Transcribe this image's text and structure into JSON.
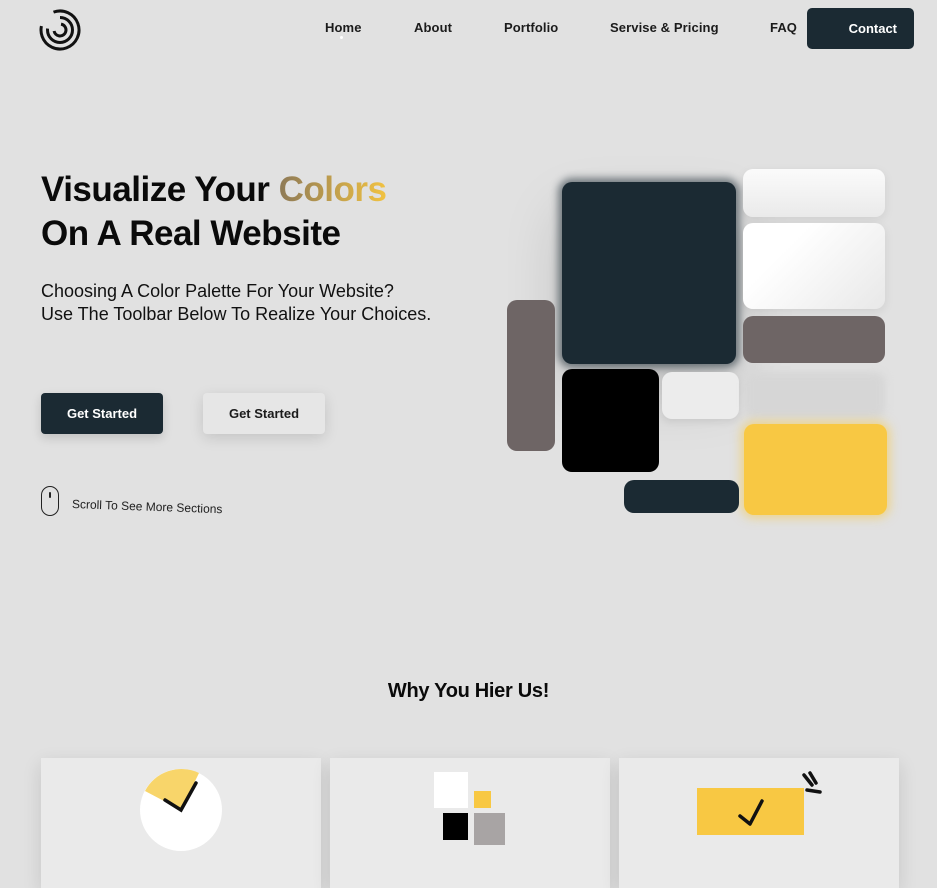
{
  "header": {
    "logo_icon": "spiral-logo-icon",
    "nav": [
      {
        "label": "Home"
      },
      {
        "label": "About"
      },
      {
        "label": "Portfolio"
      },
      {
        "label": "Servise & Pricing"
      },
      {
        "label": "FAQ"
      }
    ],
    "contact_label": "Contact"
  },
  "hero": {
    "title_part1": "Visualize Your ",
    "title_accent": "Colors",
    "title_line2": "On A Real Website",
    "subtitle_line1": "Choosing A Color Palette For Your Website?",
    "subtitle_line2": "Use The Toolbar Below To Realize Your Choices.",
    "primary_button": "Get Started",
    "secondary_button": "Get Started",
    "scroll_hint": "Scroll To See More Sections",
    "scroll_icon": "mouse-icon"
  },
  "palette": {
    "dark": "#1b2a33",
    "taupe": "#6e6565",
    "black": "#000000",
    "white": "#f3f3f3",
    "yellow": "#f8c843",
    "gray": "#a8a4a4",
    "accent_gradient": [
      "#8e7a57",
      "#f1c242"
    ]
  },
  "features": {
    "title": "Why You Hier Us!",
    "cards": [
      {
        "icon": "clock-icon"
      },
      {
        "icon": "color-squares-icon"
      },
      {
        "icon": "checkmark-badge-icon"
      }
    ]
  }
}
